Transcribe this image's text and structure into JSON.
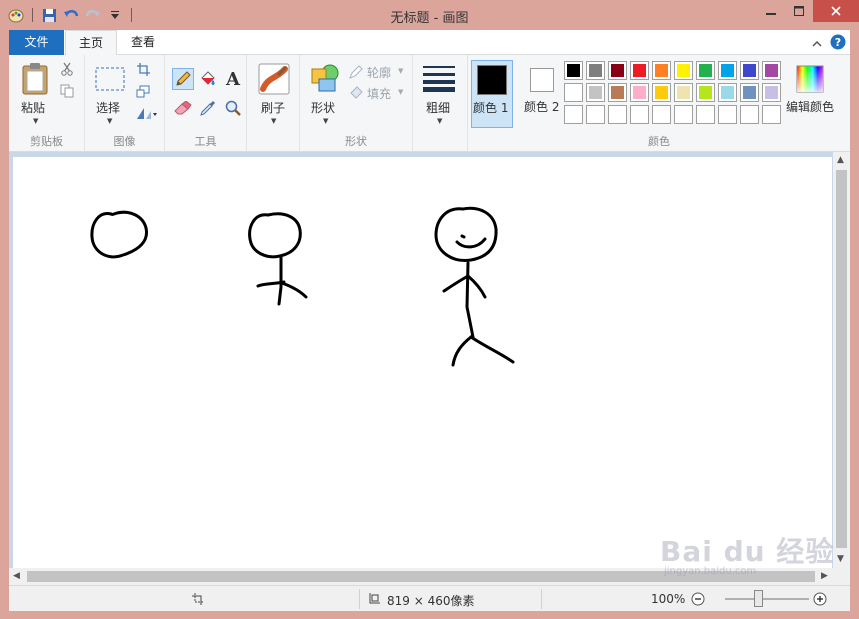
{
  "window": {
    "title": "无标题 - 画图"
  },
  "tabs": {
    "file": "文件",
    "home": "主页",
    "view": "查看"
  },
  "ribbon": {
    "clipboard": {
      "paste_label": "粘贴",
      "group_label": "剪贴板"
    },
    "image": {
      "select_label": "选择",
      "group_label": "图像"
    },
    "tools": {
      "group_label": "工具",
      "text_glyph": "A"
    },
    "brushes": {
      "label": "刷子"
    },
    "shapes": {
      "shapes_label": "形状",
      "outline_label": "轮廓",
      "fill_label": "填充",
      "group_label": "形状"
    },
    "size": {
      "label": "粗细"
    },
    "colors": {
      "color1_label": "颜色 1",
      "color2_label": "颜色 2",
      "edit_label": "编辑颜色",
      "group_label": "颜色",
      "color1_value": "#000000",
      "color2_value": "#ffffff",
      "palette_row1": [
        "#000000",
        "#7f7f7f",
        "#880015",
        "#ed1c24",
        "#ff7f27",
        "#fff200",
        "#22b14c",
        "#00a2e8",
        "#3f48cc",
        "#a349a4"
      ],
      "palette_row2": [
        "#ffffff",
        "#c3c3c3",
        "#b97a57",
        "#ffaec9",
        "#ffc90e",
        "#efe4b0",
        "#b5e61d",
        "#99d9ea",
        "#7092be",
        "#c8bfe7"
      ],
      "palette_row3": [
        "",
        "",
        "",
        "",
        "",
        "",
        "",
        "",
        "",
        ""
      ]
    }
  },
  "status": {
    "canvas_size": "819 × 460像素",
    "zoom": "100%"
  },
  "watermark": {
    "text": "Bai du 经验",
    "sub": "jingyan.baidu.com"
  }
}
